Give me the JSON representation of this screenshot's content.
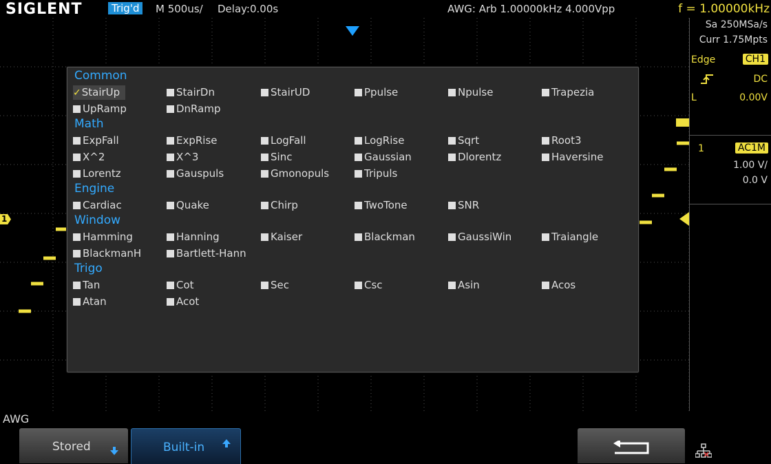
{
  "header": {
    "brand": "SIGLENT",
    "trigger_status": "Trig'd",
    "timebase": "M 500us/",
    "delay": "Delay:0.00s",
    "awg_info": "AWG: Arb  1.00000kHz  4.000Vpp",
    "frequency": "f = 1.00000kHz"
  },
  "right_panel": {
    "sample_rate": "Sa 250MSa/s",
    "memory": "Curr 1.75Mpts",
    "trigger_type": "Edge",
    "trigger_source": "CH1",
    "coupling": "DC",
    "level_label": "L",
    "level_value": "0.00V",
    "channel_number": "1",
    "channel_coupling": "AC1M",
    "volts_div": "1.00 V/",
    "offset": "0.0 V"
  },
  "channel_marker": "1",
  "dialog": {
    "sections": [
      {
        "title": "Common",
        "items": [
          "StairUp",
          "StairDn",
          "StairUD",
          "Ppulse",
          "Npulse",
          "Trapezia",
          "UpRamp",
          "DnRamp"
        ]
      },
      {
        "title": "Math",
        "items": [
          "ExpFall",
          "ExpRise",
          "LogFall",
          "LogRise",
          "Sqrt",
          "Root3",
          "X^2",
          "X^3",
          "Sinc",
          "Gaussian",
          "Dlorentz",
          "Haversine",
          "Lorentz",
          "Gauspuls",
          "Gmonopuls",
          "Tripuls"
        ]
      },
      {
        "title": "Engine",
        "items": [
          "Cardiac",
          "Quake",
          "Chirp",
          "TwoTone",
          "SNR"
        ]
      },
      {
        "title": "Window",
        "items": [
          "Hamming",
          "Hanning",
          "Kaiser",
          "Blackman",
          "GaussiWin",
          "Traiangle",
          "BlackmanH",
          "Bartlett-Hann"
        ]
      },
      {
        "title": "Trigo",
        "items": [
          "Tan",
          "Cot",
          "Sec",
          "Csc",
          "Asin",
          "Acos",
          "Atan",
          "Acot"
        ]
      }
    ],
    "selected": "StairUp"
  },
  "bottom": {
    "menu_title": "AWG",
    "stored_label": "Stored",
    "builtin_label": "Built-in"
  },
  "icons": {
    "stored_arrow": "arrow-down-icon",
    "builtin_arrow": "arrow-up-icon",
    "return": "return-arrow-icon",
    "network": "network-icon",
    "trigger_edge": "rising-edge-icon",
    "trigger_position": "trigger-position-marker-icon",
    "trigger_level": "trigger-level-marker-icon"
  },
  "colors": {
    "trace": "#f0e040",
    "section_title": "#33aaff",
    "trig_badge": "#1e8fd6",
    "builtin_text": "#4ab2ff"
  }
}
